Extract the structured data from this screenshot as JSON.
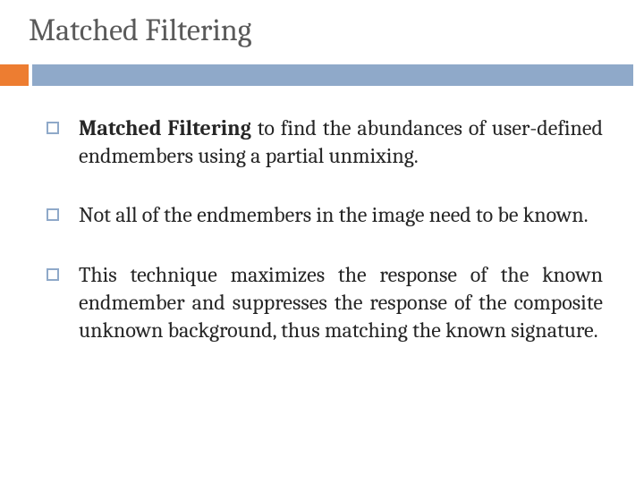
{
  "title": "Matched Filtering",
  "bullets": [
    {
      "bold": "Matched Filtering",
      "rest": " to find the abundances of user-defined endmembers using a partial unmixing."
    },
    {
      "bold": "",
      "rest": "Not all of the endmembers in the image need to be known."
    },
    {
      "bold": "",
      "rest": "This technique maximizes the response of the known endmember and suppresses the response of the composite unknown background, thus matching the known signature."
    }
  ]
}
